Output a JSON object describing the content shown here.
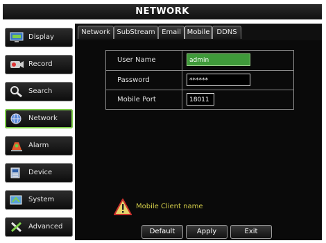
{
  "window": {
    "title": "NETWORK"
  },
  "sidebar": {
    "items": [
      {
        "label": "Display",
        "icon": "display-icon",
        "active": false
      },
      {
        "label": "Record",
        "icon": "record-icon",
        "active": false
      },
      {
        "label": "Search",
        "icon": "search-icon",
        "active": false
      },
      {
        "label": "Network",
        "icon": "network-icon",
        "active": true
      },
      {
        "label": "Alarm",
        "icon": "alarm-icon",
        "active": false
      },
      {
        "label": "Device",
        "icon": "device-icon",
        "active": false
      },
      {
        "label": "System",
        "icon": "system-icon",
        "active": false
      },
      {
        "label": "Advanced",
        "icon": "advanced-icon",
        "active": false
      }
    ]
  },
  "tabs": [
    {
      "label": "Network",
      "active": false
    },
    {
      "label": "SubStream",
      "active": false
    },
    {
      "label": "Email",
      "active": false
    },
    {
      "label": "Mobile",
      "active": true
    },
    {
      "label": "DDNS",
      "active": false
    }
  ],
  "form": {
    "user_name": {
      "label": "User Name",
      "value": "admin"
    },
    "password": {
      "label": "Password",
      "value": "******"
    },
    "mobile_port": {
      "label": "Mobile Port",
      "value": "18011"
    }
  },
  "warning": {
    "icon": "warning-icon",
    "text": "Mobile Client name"
  },
  "buttons": {
    "default": "Default",
    "apply": "Apply",
    "exit": "Exit"
  },
  "colors": {
    "accent_green": "#3f9a3a",
    "active_border": "#7fcf4a",
    "warning_text": "#d6d04a"
  }
}
